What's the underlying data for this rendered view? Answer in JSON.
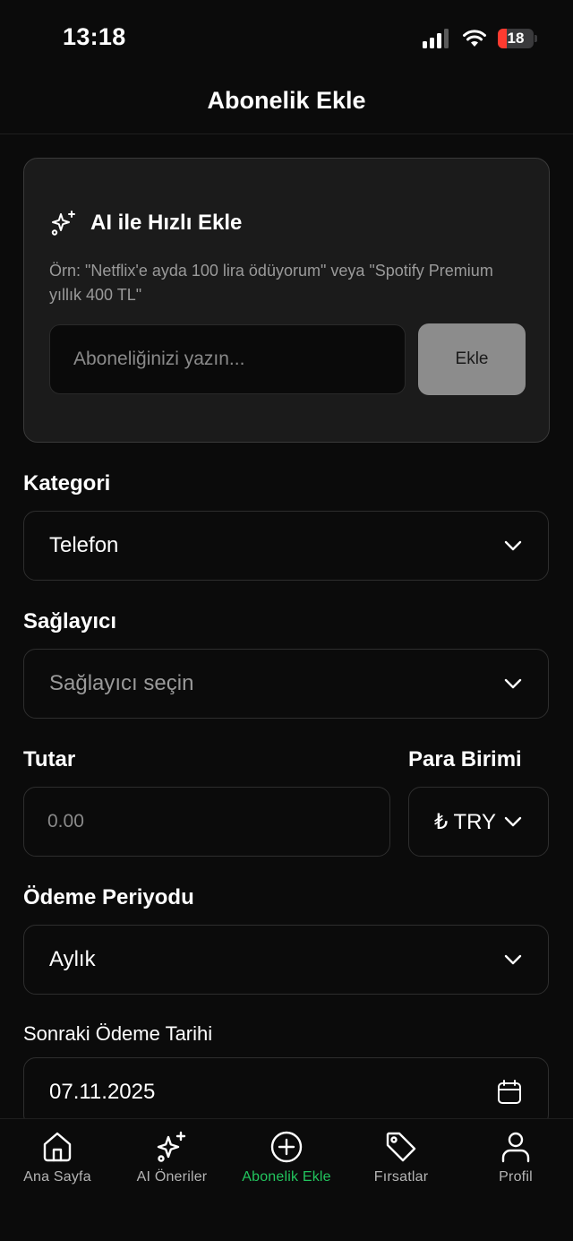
{
  "status_bar": {
    "time": "13:18",
    "battery": "18"
  },
  "header": {
    "title": "Abonelik Ekle"
  },
  "ai_card": {
    "title": "AI ile Hızlı Ekle",
    "example": "Örn: \"Netflix'e ayda 100 lira ödüyorum\" veya \"Spotify Premium yıllık 400 TL\"",
    "input_placeholder": "Aboneliğinizi yazın...",
    "add_label": "Ekle"
  },
  "form": {
    "category": {
      "label": "Kategori",
      "value": "Telefon"
    },
    "provider": {
      "label": "Sağlayıcı",
      "placeholder": "Sağlayıcı seçin"
    },
    "amount": {
      "label": "Tutar",
      "placeholder": "0.00"
    },
    "currency": {
      "label": "Para Birimi",
      "value": "₺ TRY"
    },
    "period": {
      "label": "Ödeme Periyodu",
      "value": "Aylık"
    },
    "next_payment": {
      "label": "Sonraki Ödeme Tarihi",
      "value": "07.11.2025"
    }
  },
  "bottom_nav": {
    "items": [
      {
        "label": "Ana Sayfa",
        "icon": "home-icon"
      },
      {
        "label": "AI Öneriler",
        "icon": "sparkles-icon"
      },
      {
        "label": "Abonelik Ekle",
        "icon": "plus-circle-icon",
        "active": true
      },
      {
        "label": "Fırsatlar",
        "icon": "tag-icon"
      },
      {
        "label": "Profil",
        "icon": "user-icon"
      }
    ]
  },
  "colors": {
    "accent": "#22c55e",
    "background": "#0b0b0b",
    "card": "#1b1b1b",
    "battery_low": "#ff3b30"
  }
}
